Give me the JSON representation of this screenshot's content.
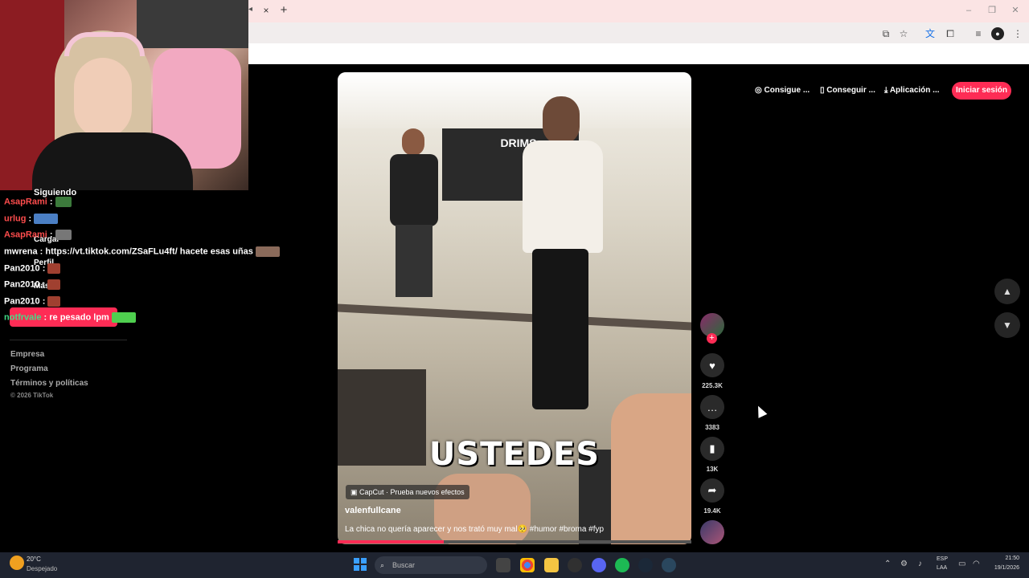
{
  "browser": {
    "tab_close": "×",
    "tab_new": "+"
  },
  "sidebar": {
    "following": "Siguiendo",
    "upload": "Cargar",
    "profile": "Perfil",
    "more": "Más",
    "login_button": "Iniciar sesión",
    "footer": {
      "company": "Empresa",
      "program": "Programa",
      "terms": "Términos y políticas",
      "copyright": "© 2026 TikTok"
    }
  },
  "chat": [
    {
      "user": "AsapRami",
      "text": " :",
      "user_color": "#ff4d4d"
    },
    {
      "user": "urlug",
      "text": " :",
      "user_color": "#ff4d4d"
    },
    {
      "user": "AsapRami",
      "text": " :",
      "user_color": "#ff4d4d"
    },
    {
      "user": "mwrena",
      "text": " : https://vt.tiktok.com/ZSaFLu4ft/ hacete esas uñas",
      "user_color": "#ffffff"
    },
    {
      "user": "Pan2010",
      "text": " :",
      "user_color": "#ffffff"
    },
    {
      "user": "Pan2010",
      "text": " :",
      "user_color": "#ffffff"
    },
    {
      "user": "Pan2010",
      "text": " :",
      "user_color": "#ffffff"
    },
    {
      "user": "notfrvale",
      "text": " : re pesado lpm",
      "user_color": "#44dd88"
    }
  ],
  "video": {
    "store_sign": "DRIMS",
    "caption_big": "USTEDES",
    "capcut_label": "CapCut · Prueba nuevos efectos",
    "author": "valenfullcane",
    "description": "La chica no quería aparecer y nos trató muy mal🥺 #humor #broma #fyp",
    "progress": 0.3
  },
  "actions": {
    "likes": "225.3K",
    "comments": "3383",
    "saves": "13K",
    "shares": "19.4K"
  },
  "topmenu": {
    "item1": "Consigue ...",
    "item2": "Conseguir ...",
    "item3": "Aplicación ...",
    "login": "Iniciar sesión"
  },
  "taskbar": {
    "weather_temp": "20°C",
    "weather_desc": "Despejado",
    "search_placeholder": "Buscar",
    "lang1": "ESP",
    "lang2": "LAA",
    "time": "21:50",
    "date": "19/1/2026"
  },
  "colors": {
    "accent": "#fe2c55",
    "background": "#000000"
  }
}
